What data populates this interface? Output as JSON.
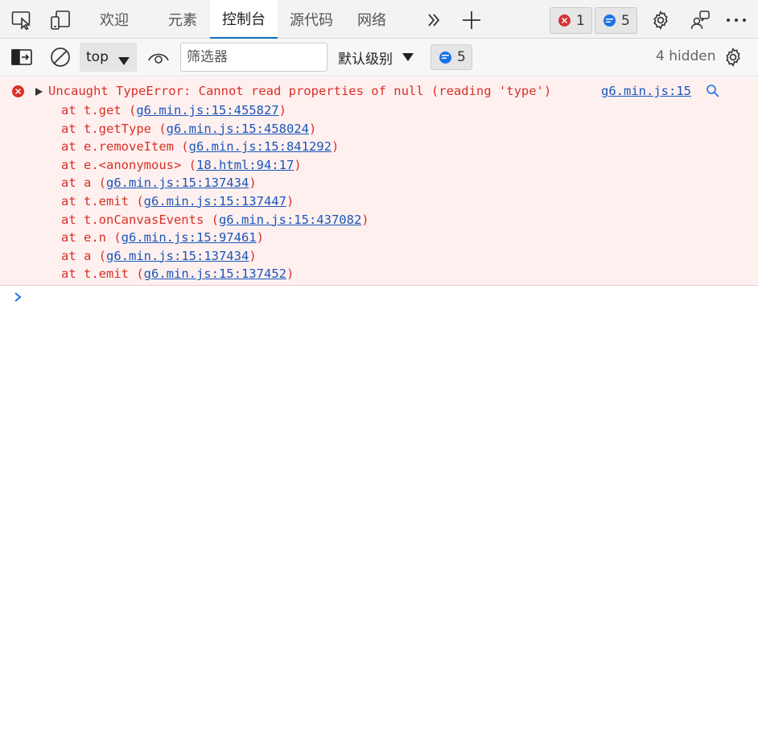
{
  "tabs": [
    {
      "label": "欢迎"
    },
    {
      "label": "元素"
    },
    {
      "label": "控制台"
    },
    {
      "label": "源代码"
    },
    {
      "label": "网络"
    }
  ],
  "badges": {
    "errors": "1",
    "messages": "5"
  },
  "toolbar": {
    "context": "top",
    "filter_placeholder": "筛选器",
    "levels": "默认级别",
    "message_count": "5",
    "hidden": "4 hidden"
  },
  "error": {
    "message": "Uncaught TypeError: Cannot read properties of null (reading 'type')",
    "source": "g6.min.js:15",
    "stack": [
      {
        "fn": "at t.get (",
        "link": "g6.min.js:15:455827",
        "end": ")"
      },
      {
        "fn": "at t.getType (",
        "link": "g6.min.js:15:458024",
        "end": ")"
      },
      {
        "fn": "at e.removeItem (",
        "link": "g6.min.js:15:841292",
        "end": ")"
      },
      {
        "fn": "at e.<anonymous> (",
        "link": "18.html:94:17",
        "end": ")"
      },
      {
        "fn": "at a (",
        "link": "g6.min.js:15:137434",
        "end": ")"
      },
      {
        "fn": "at t.emit (",
        "link": "g6.min.js:15:137447",
        "end": ")"
      },
      {
        "fn": "at t.onCanvasEvents (",
        "link": "g6.min.js:15:437082",
        "end": ")"
      },
      {
        "fn": "at e.n (",
        "link": "g6.min.js:15:97461",
        "end": ")"
      },
      {
        "fn": "at a (",
        "link": "g6.min.js:15:137434",
        "end": ")"
      },
      {
        "fn": "at t.emit (",
        "link": "g6.min.js:15:137452",
        "end": ")"
      }
    ]
  },
  "colors": {
    "accent": "#0f6cbd",
    "error": "#d93025",
    "error_bg": "#fff0f0",
    "link": "#1a56b8"
  }
}
